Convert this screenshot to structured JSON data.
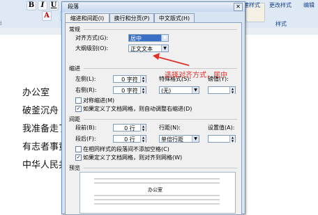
{
  "ribbon": {
    "bold": "B",
    "italic": "I",
    "underline": "U",
    "font_color": "A",
    "group_font": "字",
    "quick_styles": "快速样式",
    "change_styles": "更改样式",
    "editing": "编辑",
    "styles_group": "样式"
  },
  "document": {
    "lines": [
      "办公室",
      "破釜沉舟",
      "我准备走了",
      "有志者事竟",
      "中华人民共"
    ]
  },
  "dialog": {
    "title": "段落",
    "close": "✕",
    "tabs": [
      "缩进和间距(I)",
      "换行和分页(P)",
      "中文版式(H)"
    ],
    "general": {
      "section": "常规",
      "alignment_label": "对齐方式(G):",
      "alignment_value": "居中",
      "outline_label": "大纲级别(O):",
      "outline_value": "正文文本"
    },
    "indent": {
      "section": "缩进",
      "left_label": "左侧(L):",
      "left_value": "0 字符",
      "right_label": "右侧(R):",
      "right_value": "0 字符",
      "special_label": "特殊格式(S):",
      "special_value": "(无)",
      "by_label": "磅值(Y):",
      "mirror_label": "对称缩进(M)",
      "auto_adjust_label": "如果定义了文档网格，则自动调整右缩进(D)"
    },
    "spacing": {
      "section": "间距",
      "before_label": "段前(B):",
      "before_value": "0 行",
      "after_label": "段后(F):",
      "after_value": "0 行",
      "line_label": "行距(N):",
      "line_value": "单倍行距",
      "at_label": "设置值(A):",
      "no_space_label": "在相同样式的段落间不添加空格(C)",
      "snap_grid_label": "如果定义了文档网格，则对齐到网格(W)"
    },
    "preview": {
      "section": "预览",
      "sample": "办公室"
    }
  },
  "annotation": "选择对齐方式，居中",
  "colors": {
    "accent_selection": "#3a6fc5",
    "annotation_red": "#e0302a"
  }
}
